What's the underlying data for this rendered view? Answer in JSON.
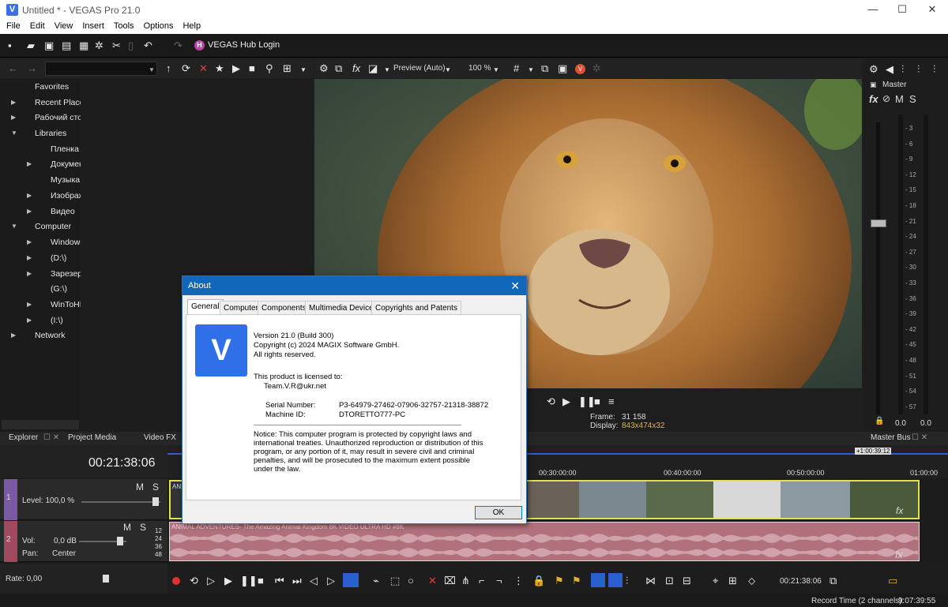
{
  "window": {
    "title": "Untitled * - VEGAS Pro 21.0",
    "app_icon": "V",
    "min": "—",
    "max": "☐",
    "close": "✕"
  },
  "menu": [
    "File",
    "Edit",
    "View",
    "Insert",
    "Tools",
    "Options",
    "Help"
  ],
  "toolbar": {
    "hub_label": "VEGAS Hub Login",
    "hub_icon": "H"
  },
  "explorer": {
    "tree": [
      {
        "label": "Favorites",
        "arrow": ""
      },
      {
        "label": "Recent Places",
        "arrow": "▶"
      },
      {
        "label": "Рабочий стол",
        "arrow": "▶"
      },
      {
        "label": "Libraries",
        "arrow": "▼"
      },
      {
        "label": "Пленка",
        "arrow": ""
      },
      {
        "label": "Документы",
        "arrow": "▶"
      },
      {
        "label": "Музыка",
        "arrow": ""
      },
      {
        "label": "Изображения",
        "arrow": "▶"
      },
      {
        "label": "Видео",
        "arrow": "▶"
      },
      {
        "label": "Computer",
        "arrow": "▼"
      },
      {
        "label": "Windows",
        "arrow": "▶"
      },
      {
        "label": "(D:\\)",
        "arrow": "▶"
      },
      {
        "label": "Зарезервировано",
        "arrow": "▶"
      },
      {
        "label": "(G:\\)",
        "arrow": ""
      },
      {
        "label": "WinToHDD",
        "arrow": "▶"
      },
      {
        "label": "(I:\\)",
        "arrow": "▶"
      },
      {
        "label": "Network",
        "arrow": "▶"
      }
    ]
  },
  "preview": {
    "mode": "Preview (Auto)",
    "zoom": "100 %",
    "frame_label": "Frame:",
    "frame_value": "31 158",
    "display_label": "Display:",
    "display_value": "843x474x32"
  },
  "mixer": {
    "master": "Master",
    "fx": "fx",
    "m": "M",
    "s": "S",
    "scale": [
      "3",
      "6",
      "9",
      "12",
      "15",
      "18",
      "21",
      "24",
      "27",
      "30",
      "33",
      "36",
      "39",
      "42",
      "45",
      "48",
      "51",
      "54",
      "57"
    ],
    "left_val": "0.0",
    "right_val": "0.0"
  },
  "tabs": {
    "explorer": "Explorer",
    "project_media": "Project Media",
    "video_fx": "Video FX",
    "master_bus": "Master Bus"
  },
  "timeline": {
    "timecode": "00:21:38:06",
    "marker": "+1:00:39:12",
    "ruler": [
      "00:30:00:00",
      "00:40:00:00",
      "00:50:00:00",
      "01:00:00"
    ],
    "track1": {
      "num": "1",
      "level": "Level: 100,0 %",
      "m": "M",
      "s": "S",
      "clip": "ANI"
    },
    "track2": {
      "num": "2",
      "vol_label": "Vol:",
      "vol_value": "0,0 dB",
      "pan_label": "Pan:",
      "pan_value": "Center",
      "m": "M",
      "s": "S",
      "clip": "ANIMAL ADVENTURES- The Amazing Animal Kingdom 8K VIDEO ULTRA HD #8K",
      "db": [
        "12",
        "24",
        "36",
        "48"
      ]
    },
    "rate": "Rate: 0,00",
    "bottom_time": "00:21:38:06"
  },
  "status": {
    "record_time_label": "Record Time (2 channels):",
    "record_time": "9:07:39:55"
  },
  "about": {
    "title": "About",
    "close": "✕",
    "tabs": [
      "General",
      "Computer",
      "Components",
      "Multimedia Devices",
      "Copyrights and Patents"
    ],
    "logo": "V",
    "version": "Version 21.0 (Build 300)",
    "copyright": "Copyright (c) 2024 MAGIX Software GmbH.",
    "rights": "All rights reserved.",
    "licensed": "This product is licensed to:",
    "licensee": "Team.V.R@ukr.net",
    "serial_label": "Serial Number:",
    "serial": "P3-64979-27462-07906-32757-21318-38872",
    "machine_label": "Machine ID:",
    "machine": "DTORETTO777-PC",
    "notice": [
      "Notice: This computer program is protected by copyright laws and",
      "international treaties. Unauthorized reproduction or distribution of this",
      "program, or any portion of it, may result in severe civil and criminal",
      "penalties, and will be prosecuted to the maximum extent possible",
      "under the law."
    ],
    "ok": "OK"
  }
}
